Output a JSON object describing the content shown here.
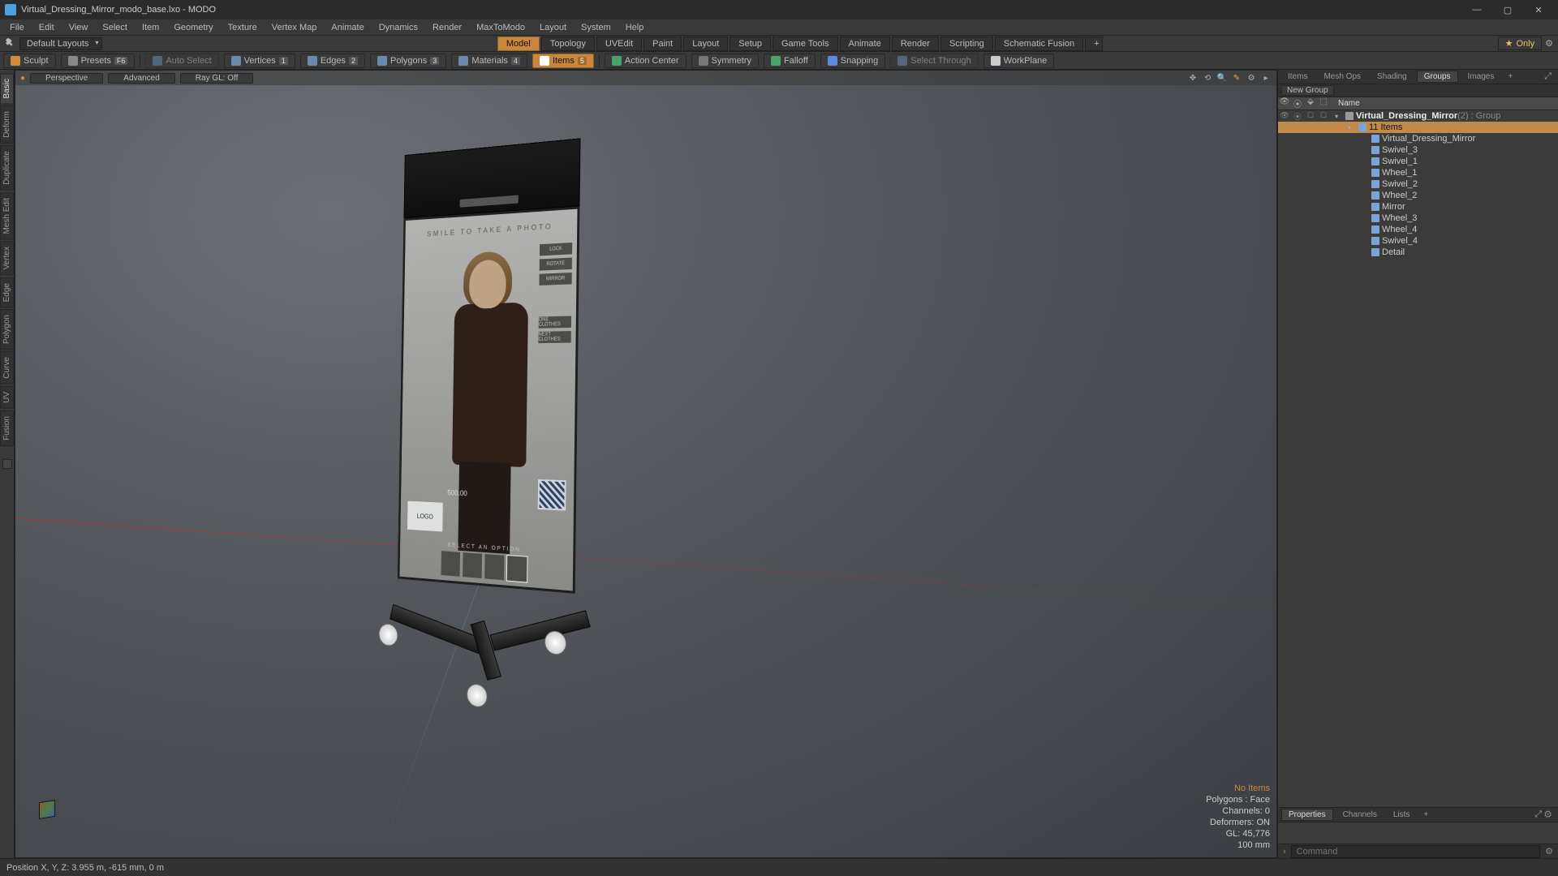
{
  "titlebar": {
    "title": "Virtual_Dressing_Mirror_modo_base.lxo - MODO"
  },
  "menu": [
    "File",
    "Edit",
    "View",
    "Select",
    "Item",
    "Geometry",
    "Texture",
    "Vertex Map",
    "Animate",
    "Dynamics",
    "Render",
    "MaxToModo",
    "Layout",
    "System",
    "Help"
  ],
  "layout": {
    "dropdown": "Default Layouts",
    "tabs": [
      "Model",
      "Topology",
      "UVEdit",
      "Paint",
      "Layout",
      "Setup",
      "Game Tools",
      "Animate",
      "Render",
      "Scripting",
      "Schematic Fusion"
    ],
    "active": "Model",
    "only": "Only"
  },
  "toolbar": {
    "sculpt": "Sculpt",
    "presets": "Presets",
    "presets_badge": "F6",
    "auto_select": "Auto Select",
    "vertices": "Vertices",
    "vertices_key": "1",
    "edges": "Edges",
    "edges_key": "2",
    "polygons": "Polygons",
    "polygons_key": "3",
    "materials": "Materials",
    "materials_key": "4",
    "items": "Items",
    "items_key": "5",
    "action_center": "Action Center",
    "symmetry": "Symmetry",
    "falloff": "Falloff",
    "snapping": "Snapping",
    "select_through": "Select Through",
    "workplane": "WorkPlane"
  },
  "left_tabs": [
    "Basic",
    "Deform",
    "Duplicate",
    "Mesh Edit",
    "Vertex",
    "Edge",
    "Polygon",
    "Curve",
    "UV",
    "Fusion"
  ],
  "viewport": {
    "persp": "Perspective",
    "advanced": "Advanced",
    "raygl": "Ray GL: Off",
    "info_noitems": "No Items",
    "info_polys": "Polygons : Face",
    "info_channels": "Channels: 0",
    "info_deformers": "Deformers: ON",
    "info_gl": "GL: 45,776",
    "info_scale": "100 mm"
  },
  "mirror_ui": {
    "hint": "SMILE TO TAKE A PHOTO",
    "side": [
      "LOCK",
      "ROTATE",
      "MIRROR",
      "ONE CLOTHES",
      "NEXT CLOTHES"
    ],
    "logo": "LOGO",
    "price": "500.00",
    "select": "SELECT AN OPTION"
  },
  "right": {
    "tabs_top": [
      "Items",
      "Mesh Ops",
      "Shading",
      "Groups",
      "Images"
    ],
    "tabs_top_active": "Groups",
    "new_group": "New Group",
    "col_name": "Name",
    "group_name": "Virtual_Dressing_Mirror",
    "group_suffix": " (2) : Group",
    "subgroup": "11 Items",
    "items": [
      "Virtual_Dressing_Mirror",
      "Swivel_3",
      "Swivel_1",
      "Wheel_1",
      "Swivel_2",
      "Wheel_2",
      "Mirror",
      "Wheel_3",
      "Wheel_4",
      "Swivel_4",
      "Detail"
    ],
    "tabs_bottom": [
      "Properties",
      "Channels",
      "Lists"
    ],
    "tabs_bottom_active": "Properties",
    "command_ph": "Command"
  },
  "status": {
    "pos": "Position X, Y, Z:   3.955 m, -615 mm, 0 m"
  }
}
